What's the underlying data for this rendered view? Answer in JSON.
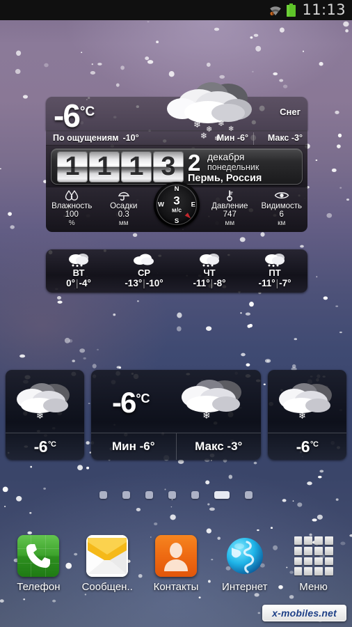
{
  "colors": {
    "accent_blue": "#1d3f86",
    "battery_green": "#5ec329",
    "phone_green": "#3da32c",
    "contacts_orange": "#ee6a12",
    "msg_yellow": "#f5b919",
    "needle_red": "#c1272d"
  },
  "statusbar": {
    "time": "11:13",
    "icons": [
      "wifi-icon",
      "battery-icon"
    ]
  },
  "weather_widget": {
    "temperature": "-6",
    "temperature_unit": "°C",
    "condition": "Снег",
    "feels_like_label": "По ощущениям",
    "feels_like_value": "-10°",
    "min_label": "Мин",
    "min_value": "-6°",
    "max_label": "Макс",
    "max_value": "-3°",
    "condition_icon": "snow-cloud-icon",
    "clock": {
      "digits": [
        "1",
        "1",
        "1",
        "3"
      ]
    },
    "date": {
      "day": "2",
      "month": "декабря",
      "weekday": "понедельник",
      "location": "Пермь, Россия"
    },
    "metrics": [
      {
        "icon": "humidity-icon",
        "label": "Влажность",
        "value": "100",
        "unit": "%"
      },
      {
        "icon": "umbrella-icon",
        "label": "Осадки",
        "value": "0.3",
        "unit": "мм"
      },
      {
        "icon": "pressure-icon",
        "label": "Давление",
        "value": "747",
        "unit": "мм"
      },
      {
        "icon": "visibility-icon",
        "label": "Видимость",
        "value": "6",
        "unit": "км"
      }
    ],
    "compass": {
      "north": "N",
      "south": "S",
      "west": "W",
      "east": "E",
      "speed": "3",
      "speed_unit": "м/с"
    }
  },
  "forecast": [
    {
      "day": "ВТ",
      "icon": "snow-cloud-icon",
      "low": "0°",
      "high": "-4°"
    },
    {
      "day": "СР",
      "icon": "cloud-icon",
      "low": "-13°",
      "high": "-10°"
    },
    {
      "day": "ЧТ",
      "icon": "snow-cloud-icon",
      "low": "-11°",
      "high": "-8°"
    },
    {
      "day": "ПТ",
      "icon": "snow-cloud-icon",
      "low": "-11°",
      "high": "-7°"
    }
  ],
  "bottom_widgets": {
    "left": {
      "icon": "snow-cloud-icon",
      "temp": "-6",
      "unit": "°C"
    },
    "right": {
      "icon": "snow-cloud-icon",
      "temp": "-6",
      "unit": "°C"
    },
    "center": {
      "icon": "snow-cloud-icon",
      "temp": "-6",
      "unit": "°C",
      "min_label": "Мин -6°",
      "max_label": "Макс -3°"
    }
  },
  "page_indicator": {
    "total": 7,
    "active_index": 5
  },
  "dock": [
    {
      "icon": "phone-icon",
      "label": "Телефон"
    },
    {
      "icon": "message-icon",
      "label": "Сообщен.."
    },
    {
      "icon": "contacts-icon",
      "label": "Контакты"
    },
    {
      "icon": "browser-icon",
      "label": "Интернет"
    },
    {
      "icon": "app-grid-icon",
      "label": "Меню"
    }
  ],
  "watermark": {
    "text": "x-mobiles.net"
  }
}
